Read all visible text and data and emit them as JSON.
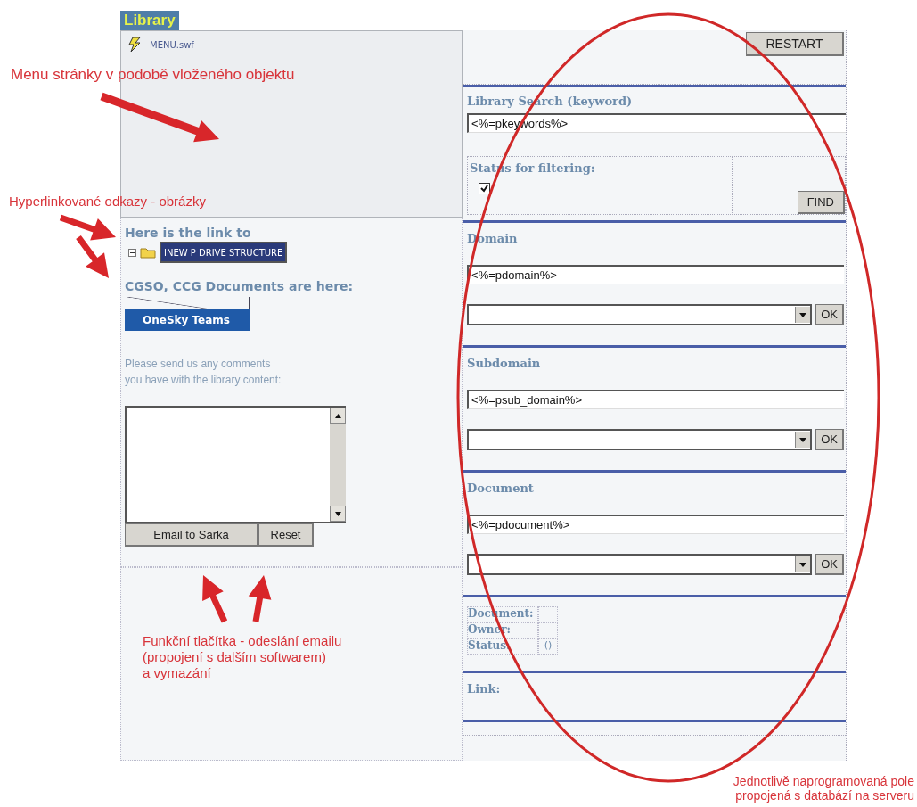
{
  "header": {
    "title": "Library"
  },
  "menu_object": {
    "file": "MENU.swf"
  },
  "left": {
    "link_heading": "Here is the link to",
    "tree_item": {
      "label": "INEW P DRIVE STRUCTURE",
      "expanded": true,
      "selected": true
    },
    "docs_heading": "CGSO, CCG Documents are here:",
    "banner": "OneSky Teams",
    "comment_prompt": "Please send us any comments\nyou have with the library content:",
    "buttons": [
      "Email to Sarka",
      "Reset"
    ]
  },
  "right": {
    "restart": "RESTART",
    "search_label": "Library Search (keyword)",
    "search_value": "<%=pkeywords%>",
    "status_label": "Status for filtering:",
    "status_checked": true,
    "find": "FIND",
    "sections": [
      {
        "label": "Domain",
        "value": "<%=pdomain%>",
        "ok": "OK"
      },
      {
        "label": "Subdomain",
        "value": "<%=psub_domain%>",
        "ok": "OK"
      },
      {
        "label": "Document",
        "value": "<%=pdocument%>",
        "ok": "OK"
      }
    ],
    "details": [
      {
        "label": "Document:"
      },
      {
        "label": "Owner:"
      },
      {
        "label": "Status:",
        "value": "()"
      }
    ],
    "link_label": "Link:"
  },
  "annotations": [
    {
      "kind": "menu",
      "text": "Menu stránky v podobě vloženého objektu"
    },
    {
      "kind": "links",
      "text": "Hyperlinkované odkazy - obrázky"
    },
    {
      "kind": "buttons",
      "text": "Funkční tlačítka - odeslání emailu\n(propojení s dalším softwarem)\na vymazání"
    },
    {
      "kind": "fields",
      "text": "Jednotlivě naprogramovaná pole\npropojená s databází na serveru"
    }
  ]
}
